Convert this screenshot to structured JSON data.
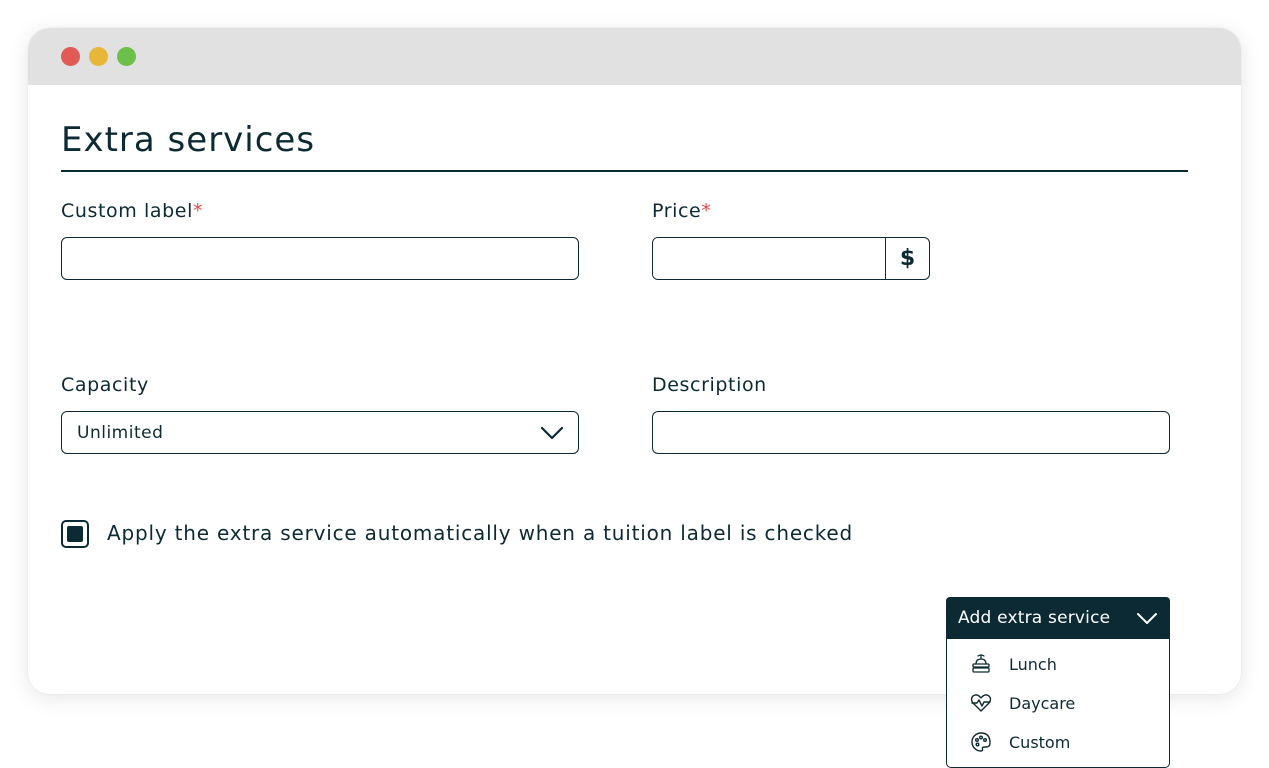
{
  "window": {
    "traffic_lights": {
      "close": "#e05b55",
      "minimize": "#e8b73a",
      "maximize": "#6cc04a"
    }
  },
  "form": {
    "title": "Extra services",
    "custom_label": {
      "label": "Custom label",
      "required_mark": "*",
      "value": ""
    },
    "price": {
      "label": "Price",
      "required_mark": "*",
      "value": "",
      "suffix": "$"
    },
    "capacity": {
      "label": "Capacity",
      "selected": "Unlimited"
    },
    "description": {
      "label": "Description",
      "value": ""
    },
    "auto_apply": {
      "label": "Apply the extra service automatically when a tuition label is checked",
      "checked": true
    }
  },
  "add_service": {
    "button_label": "Add extra service",
    "items": [
      {
        "label": "Lunch",
        "icon": "lunch-icon"
      },
      {
        "label": "Daycare",
        "icon": "heart-pulse-icon"
      },
      {
        "label": "Custom",
        "icon": "palette-icon"
      }
    ]
  },
  "colors": {
    "primary": "#0c2a33",
    "required": "#e04848",
    "titlebar": "#e1e1e1"
  }
}
